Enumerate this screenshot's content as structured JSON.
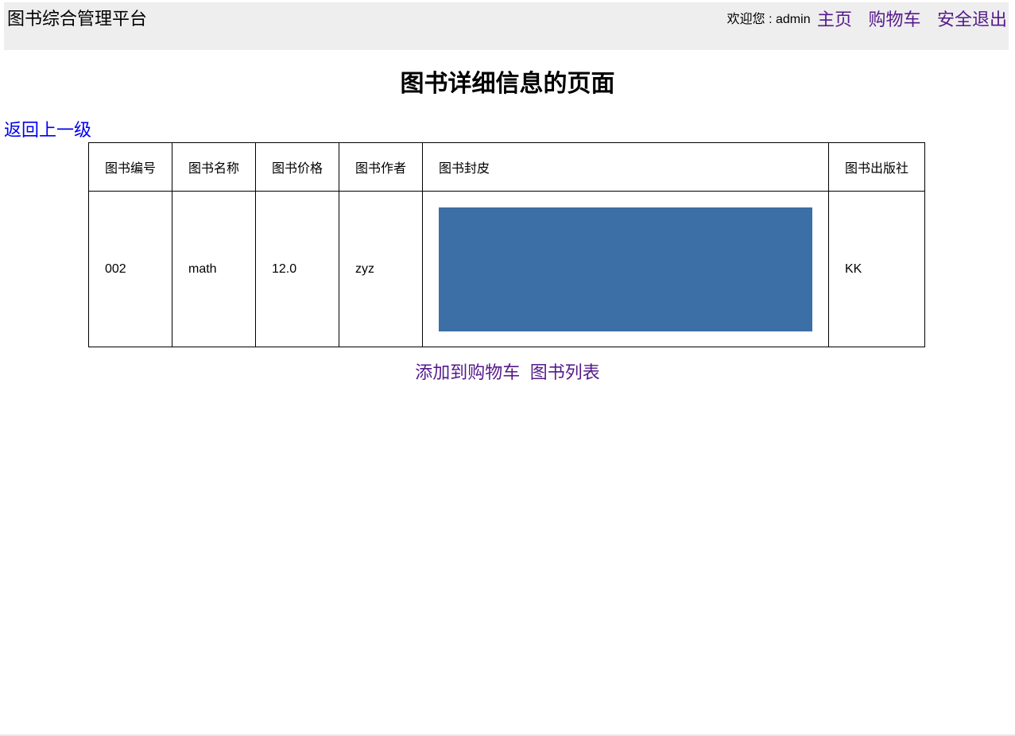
{
  "header": {
    "brand": "图书综合管理平台",
    "welcome": "欢迎您 : admin",
    "nav": {
      "home": "主页",
      "cart": "购物车",
      "logout": "安全退出"
    }
  },
  "page": {
    "title": "图书详细信息的页面",
    "back_link": "返回上一级"
  },
  "table": {
    "headers": {
      "id": "图书编号",
      "name": "图书名称",
      "price": "图书价格",
      "author": "图书作者",
      "cover": "图书封皮",
      "publisher": "图书出版社"
    },
    "row": {
      "id": "002",
      "name": "math",
      "price": "12.0",
      "author": "zyz",
      "publisher": "KK"
    }
  },
  "actions": {
    "add_to_cart": "添加到购物车",
    "book_list": "图书列表"
  },
  "colors": {
    "header_bg": "#eeeeee",
    "visited_link": "#551a8b",
    "link": "#0000ee",
    "cover_placeholder": "#3c6fa5"
  }
}
